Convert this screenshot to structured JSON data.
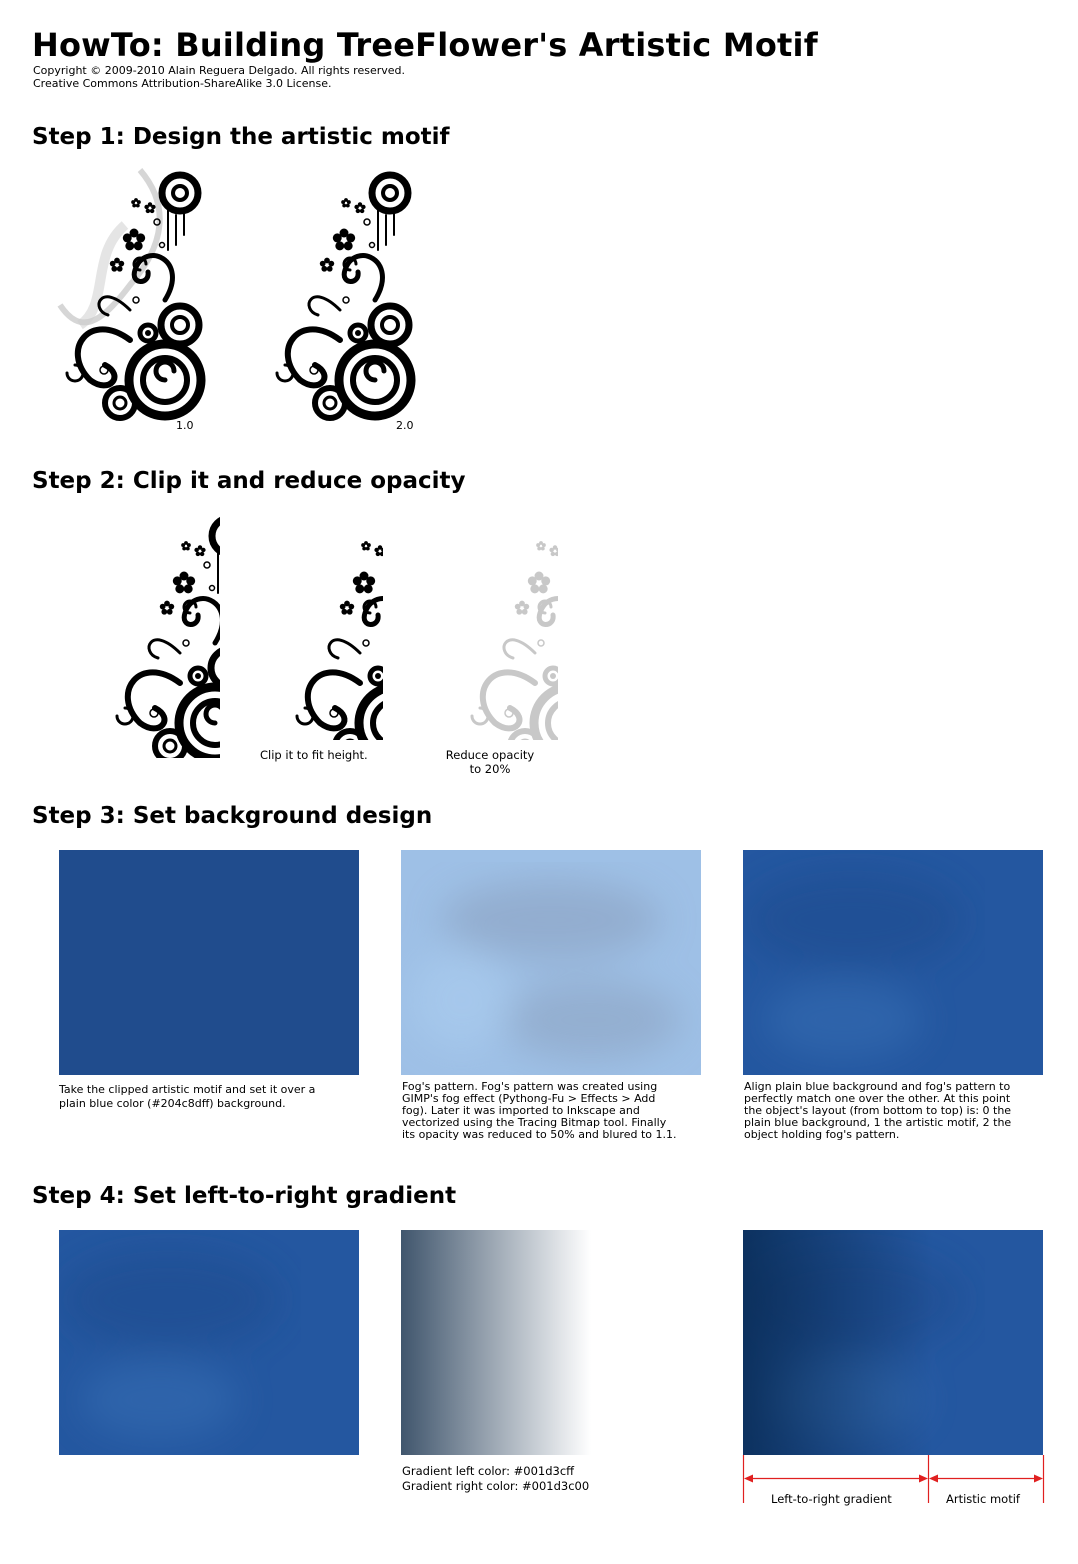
{
  "title": "HowTo: Building TreeFlower's Artistic Motif",
  "copyright": [
    "Copyright © 2009-2010 Alain Reguera Delgado. All rights reserved.",
    "Creative Commons Attribution-ShareAlike 3.0 License."
  ],
  "step1": {
    "heading": "Step 1: Design the artistic motif",
    "label_v1": "1.0",
    "label_v2": "2.0"
  },
  "step2": {
    "heading": "Step 2: Clip it and reduce opacity",
    "clip_caption": "Clip it to fit height.",
    "opacity_caption": [
      "Reduce opacity",
      "to 20%"
    ]
  },
  "step3": {
    "heading": "Step 3: Set background design",
    "caption1": [
      "Take the clipped artistic motif and set it over a",
      "plain blue color (#204c8dff) background."
    ],
    "caption2": [
      "Fog's pattern. Fog's pattern was created using",
      "GIMP's fog effect (Pythong-Fu > Effects > Add",
      "fog). Later it was imported to Inkscape and",
      "vectorized using the Tracing Bitmap tool. Finally",
      "its opacity was reduced to 50% and blured to 1.1."
    ],
    "caption3": [
      "Align plain blue background and fog's pattern to",
      "perfectly match one over the other. At this point",
      "the object's layout (from bottom to top) is: 0 the",
      "plain blue background, 1 the artistic motif, 2 the",
      "object holding fog's pattern."
    ]
  },
  "step4": {
    "heading": "Step 4: Set left-to-right gradient",
    "gradient_left": "Gradient left color: #001d3cff",
    "gradient_right": "Gradient right color: #001d3c00",
    "label_gradient": "Left-to-right gradient",
    "label_motif": "Artistic motif"
  },
  "colors": {
    "plain_blue": "#204c8d",
    "gradient": "#001d3c",
    "fog": "#9bbde3",
    "measure": "#e02020"
  }
}
